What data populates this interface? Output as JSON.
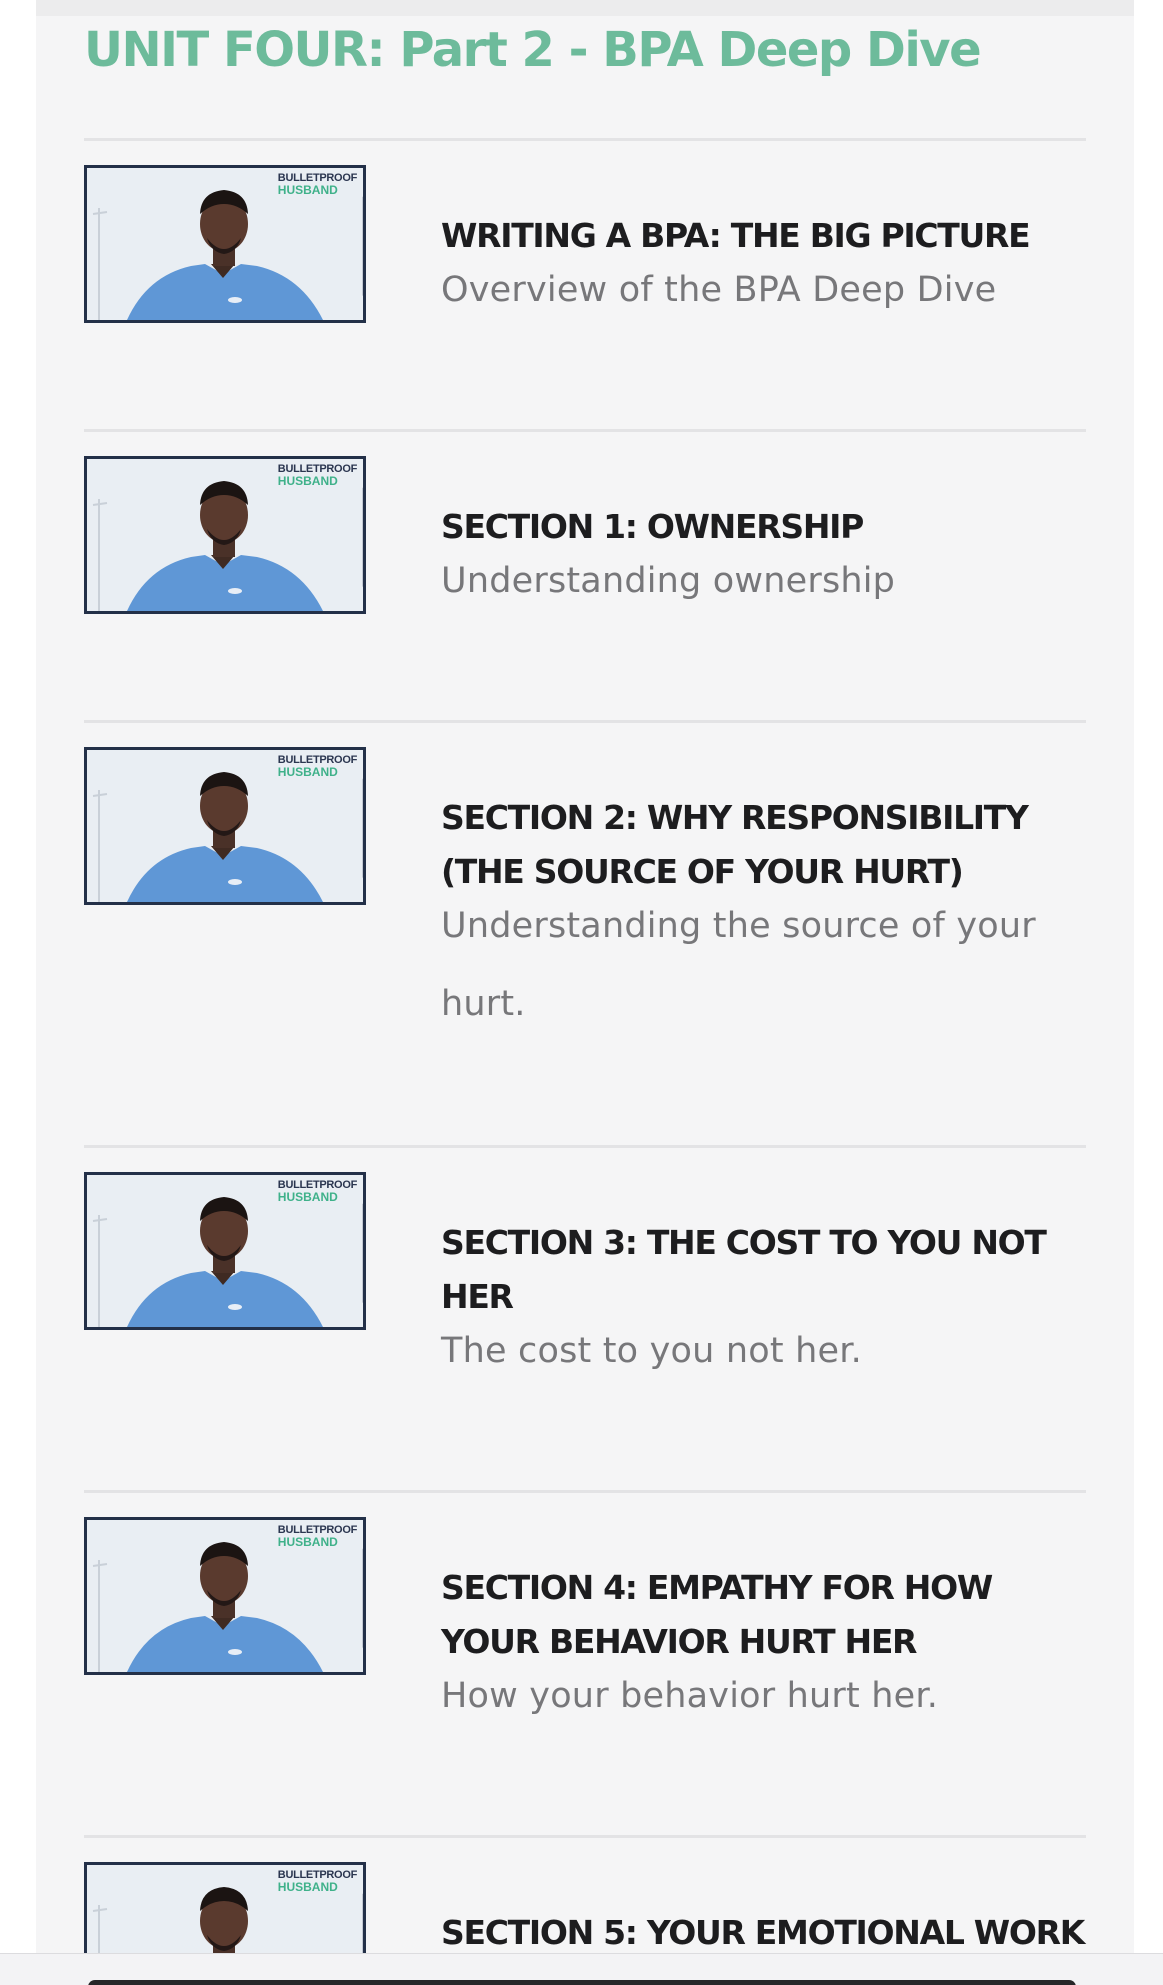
{
  "unit_title": "UNIT FOUR: Part 2 - BPA Deep Dive",
  "thumbnail": {
    "brand_line1": "BULLETPROOF",
    "brand_line2": "HUSBAND",
    "brand_prefix": "▪",
    "shirt_color": "#5f97d6",
    "border_color": "#233048"
  },
  "lessons": [
    {
      "title": "WRITING A BPA: THE BIG PICTURE",
      "subtitle": "Overview of the BPA Deep Dive"
    },
    {
      "title": "SECTION 1: OWNERSHIP",
      "subtitle": "Understanding ownership"
    },
    {
      "title": "SECTION 2: WHY RESPONSIBILITY (THE SOURCE OF YOUR HURT)",
      "subtitle": "Understanding the source of your hurt."
    },
    {
      "title": "SECTION 3: THE COST TO YOU NOT HER",
      "subtitle": "The cost to you not her."
    },
    {
      "title": "SECTION 4: EMPATHY FOR HOW YOUR BEHAVIOR HURT HER",
      "subtitle": "How your behavior hurt her."
    },
    {
      "title": "SECTION 5: YOUR EMOTIONAL WORK",
      "subtitle": ""
    }
  ],
  "colors": {
    "accent": "#6dbb9b",
    "title_text": "#1d1d1f",
    "subtitle_text": "#77777a",
    "panel_bg": "#f5f5f6"
  }
}
